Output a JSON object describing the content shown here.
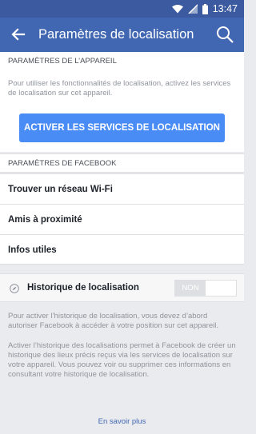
{
  "status_bar": {
    "time": "13:47"
  },
  "app_bar": {
    "title": "Paramètres de localisation"
  },
  "device_section": {
    "header": "PARAMÈTRES DE L’APPAREIL",
    "description": "Pour utiliser les fonctionnalités de localisation, activez les services de localisation sur cet appareil.",
    "button_label": "ACTIVER LES SERVICES DE LOCALISATION"
  },
  "facebook_section": {
    "header": "PARAMÈTRES DE FACEBOOK",
    "items": [
      {
        "label": "Trouver un réseau Wi-Fi"
      },
      {
        "label": "Amis à proximité"
      },
      {
        "label": "Infos utiles"
      }
    ]
  },
  "history": {
    "label": "Historique de localisation",
    "toggle_label": "NON",
    "info_1": "Pour activer l’historique de localisation, vous devez d’abord autoriser Facebook à accéder à votre position sur cet appareil.",
    "info_2": "Activer l’historique des localisations permet à Facebook de créer un historique des lieux précis reçus via les services de localisation sur votre appareil. Vous pouvez voir ou supprimer ces informations en consultant votre historique de localisation.",
    "learn_more": "En savoir plus"
  },
  "icons": {
    "back": "back-arrow-icon",
    "search": "search-icon",
    "wifi": "wifi-icon",
    "signal": "signal-icon",
    "battery": "battery-icon",
    "compass": "compass-icon"
  },
  "colors": {
    "status_bar": "#3b5aa0",
    "app_bar": "#4267b2",
    "button": "#4a8cf5",
    "link": "#4267b2"
  }
}
